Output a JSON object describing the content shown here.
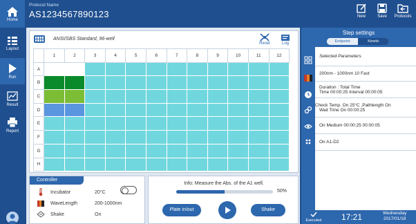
{
  "header": {
    "home_label": "Home",
    "protocol_label": "Protocol Name",
    "protocol_id": "AS1234567890123",
    "new_label": "New",
    "save_label": "Save",
    "protocols_label": "Protocols"
  },
  "sidebar": {
    "items": [
      {
        "label": "Layout",
        "icon": "layout-icon"
      },
      {
        "label": "Run",
        "icon": "play-icon"
      },
      {
        "label": "Result",
        "icon": "chart-icon"
      },
      {
        "label": "Report",
        "icon": "printer-icon"
      }
    ]
  },
  "plate": {
    "title": "ANSI/SBS Standard, 96-well",
    "reset_label": "Reset",
    "log_label": "Log",
    "columns": [
      "1",
      "2",
      "3",
      "4",
      "5",
      "6",
      "7",
      "8",
      "9",
      "10",
      "11",
      "12"
    ],
    "rows": [
      "A",
      "B",
      "C",
      "D",
      "E",
      "F",
      "G",
      "H"
    ],
    "colors": {
      "empty": "#71d7de",
      "white": "#ffffff",
      "green": "#0a8a2a",
      "light_green": "#7cbd36",
      "blue": "#5a96df"
    }
  },
  "controller": {
    "tab_label": "Controller",
    "rows": [
      {
        "icon": "thermometer-icon",
        "name": "Incubator",
        "value": "20°C"
      },
      {
        "icon": "spectrum-icon",
        "name": "WaveLength",
        "value": "200-1000nm"
      },
      {
        "icon": "shake-icon",
        "name": "Shake",
        "value": "On"
      }
    ]
  },
  "run": {
    "info": "Info: Measure the Abs. of the A1 well.",
    "progress_percent": 50,
    "progress_text": "50%",
    "plate_btn": "Plate in/out",
    "shake_btn": "Shake"
  },
  "step_settings": {
    "title": "Step settings",
    "tab_endpoint": "Endpoint",
    "tab_kinetic": "Kinetic",
    "selected_label": "Selected Parameters",
    "wavelength_line": "200nm - 1000nm   10   Fast",
    "duration_line1": "Duration : Total Time",
    "duration_line2": "Time  00:00:25      Interval  00:00:05",
    "check_line1": "Check Temp.  On  25°C  ,Pathlength  On",
    "check_line2": "Wait Time   On  00:00:25",
    "shake_line": "On   Medium   00:00:25   00:00:05",
    "wells_line": "On   A1-D2"
  },
  "status": {
    "executed": "Executed",
    "time": "17:21",
    "weekday": "Wednesday",
    "date": "2017/01/18"
  }
}
